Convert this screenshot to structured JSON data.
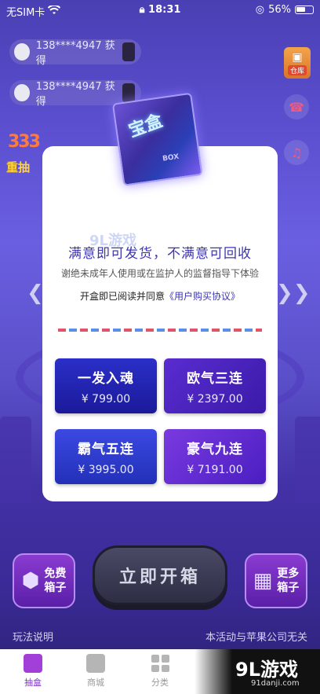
{
  "status": {
    "carrier": "无SIM卡",
    "time": "18:31",
    "battery": "56%",
    "battery_level": 0.56
  },
  "tickers": [
    {
      "text": "138****4947 获得"
    },
    {
      "text": "138****4947 获得"
    }
  ],
  "floating": {
    "warehouse_label": "仓库"
  },
  "promo": {
    "num": "333",
    "text": "重抽"
  },
  "modal": {
    "cube_title": "宝盒",
    "cube_sub": "BOX",
    "title": "满意即可发货，不满意可回收",
    "warning": "谢绝未成年人使用或在监护人的监督指导下体验",
    "agree_prefix": "开盒即已阅读并同意",
    "agree_link": "《用户购买协议》",
    "options": [
      {
        "name": "一发入魂",
        "price": "¥ 799.00"
      },
      {
        "name": "欧气三连",
        "price": "¥ 2397.00"
      },
      {
        "name": "霸气五连",
        "price": "¥ 3995.00"
      },
      {
        "name": "豪气九连",
        "price": "¥ 7191.00"
      }
    ]
  },
  "actions": {
    "free_box": "免费\n箱子",
    "free_box_l1": "免费",
    "free_box_l2": "箱子",
    "open_now": "立即开箱",
    "more_box_l1": "更多",
    "more_box_l2": "箱子"
  },
  "footer": {
    "rules": "玩法说明",
    "disclaimer": "本活动与苹果公司无关"
  },
  "tabs": [
    {
      "label": "抽盒"
    },
    {
      "label": "商城"
    },
    {
      "label": "分类"
    }
  ],
  "brand": {
    "logo": "9L游戏",
    "url": "91danji.com"
  }
}
